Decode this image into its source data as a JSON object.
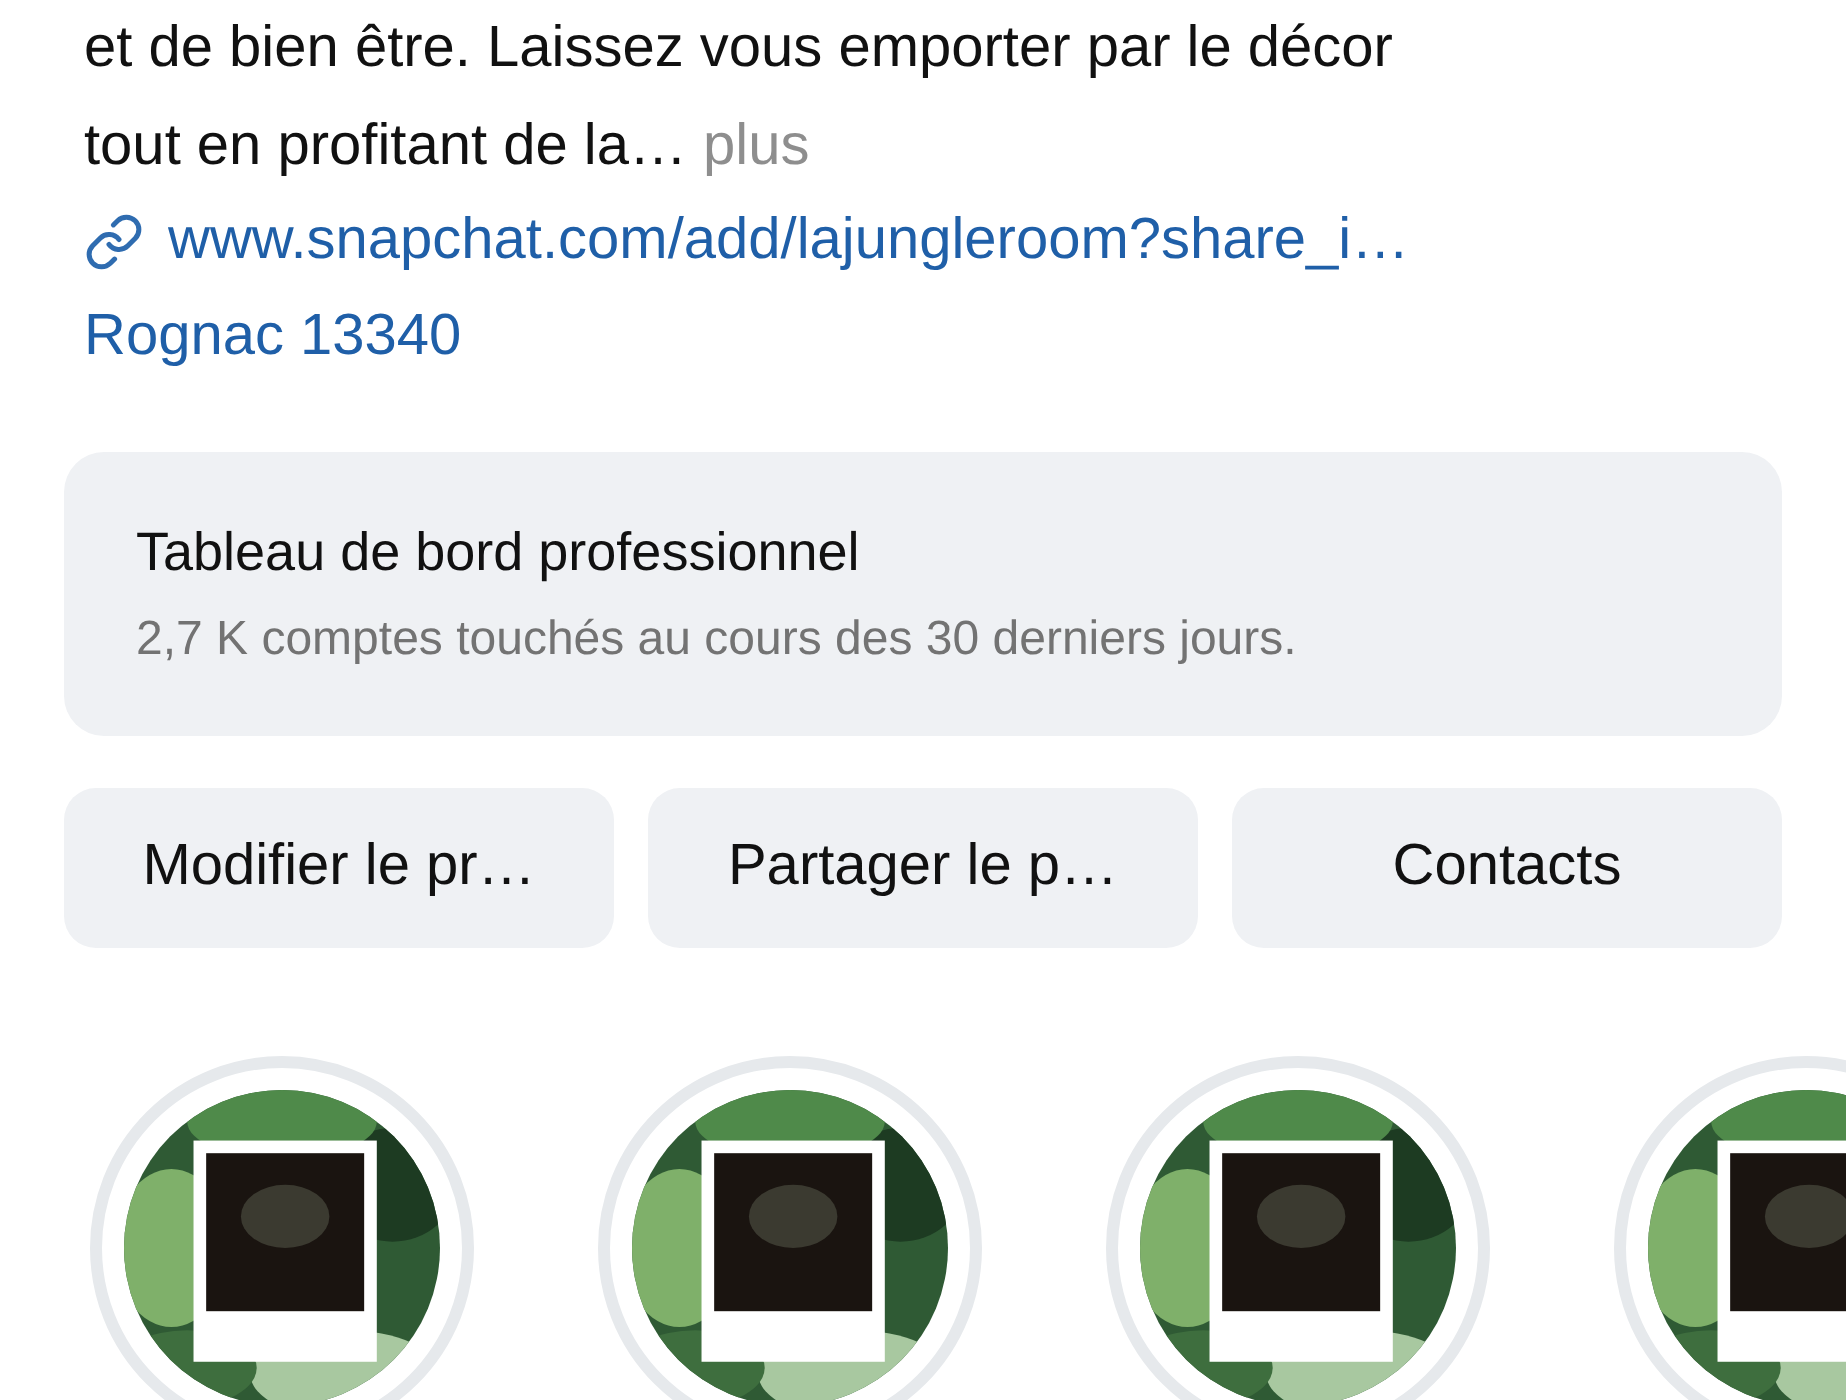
{
  "bio": {
    "lines": [
      "et de bien être. Laissez vous emporter par le décor",
      "tout en profitant de la…"
    ],
    "more": "plus"
  },
  "link": {
    "text": "www.snapchat.com/add/lajungleroom?share_i…"
  },
  "location": "Rognac 13340",
  "dashboard": {
    "title": "Tableau de bord professionnel",
    "subtitle": "2,7 K comptes touchés au cours des 30 derniers jours."
  },
  "buttons": [
    "Modifier le pr…",
    "Partager le p…",
    "Contacts"
  ],
  "highlights": [
    {
      "kind": "picture"
    },
    {
      "kind": "picture"
    },
    {
      "kind": "picture"
    },
    {
      "kind": "picture"
    }
  ]
}
